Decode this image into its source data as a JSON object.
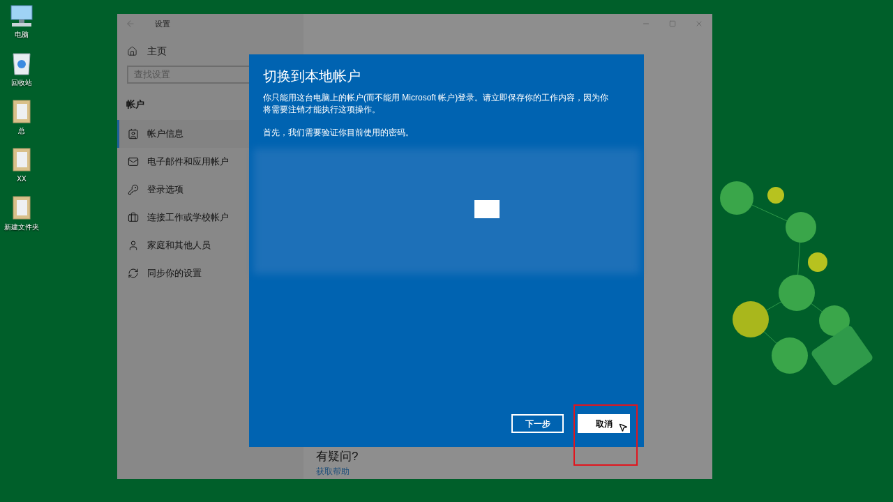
{
  "desktop": {
    "icons": [
      {
        "label": "电脑",
        "kind": "computer"
      },
      {
        "label": "回收站",
        "kind": "recycle"
      },
      {
        "label": "总",
        "kind": "folder"
      },
      {
        "label": "XX",
        "kind": "folder"
      },
      {
        "label": "新建文件夹",
        "kind": "folder"
      }
    ]
  },
  "settings_window": {
    "title": "设置",
    "home": "主页",
    "search": {
      "placeholder": "查找设置"
    },
    "section": "帐户",
    "nav": [
      {
        "label": "帐户信息",
        "selected": true
      },
      {
        "label": "电子邮件和应用帐户",
        "selected": false
      },
      {
        "label": "登录选项",
        "selected": false
      },
      {
        "label": "连接工作或学校帐户",
        "selected": false
      },
      {
        "label": "家庭和其他人员",
        "selected": false
      },
      {
        "label": "同步你的设置",
        "selected": false
      }
    ],
    "help_heading": "有疑问?",
    "help_link": "获取帮助"
  },
  "dialog": {
    "title": "切换到本地帐户",
    "paragraphs": [
      "你只能用这台电脑上的帐户(而不能用 Microsoft 帐户)登录。请立即保存你的工作内容，因为你将需要注销才能执行这项操作。",
      "首先，我们需要验证你目前使用的密码。"
    ],
    "buttons": [
      {
        "label": "下一步",
        "kind": "outline",
        "highlighted": false
      },
      {
        "label": "取消",
        "kind": "solid",
        "highlighted": true
      }
    ]
  }
}
